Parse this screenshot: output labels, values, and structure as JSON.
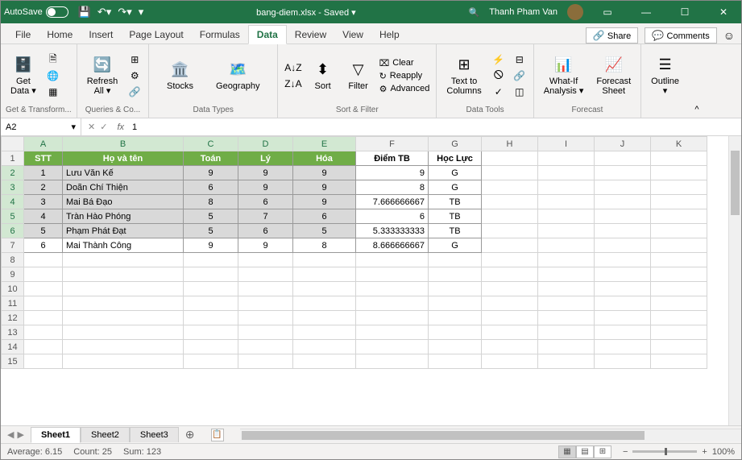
{
  "title": {
    "autosave": "AutoSave",
    "filename": "bang-diem.xlsx",
    "saved": "- Saved ▾",
    "user": "Thanh Pham Van"
  },
  "tabs": [
    "File",
    "Home",
    "Insert",
    "Page Layout",
    "Formulas",
    "Data",
    "Review",
    "View",
    "Help"
  ],
  "activeTab": "Data",
  "share": "Share",
  "comments": "Comments",
  "ribbon": {
    "getdata": "Get\nData ▾",
    "refreshall": "Refresh\nAll ▾",
    "stocks": "Stocks",
    "geo": "Geography",
    "sort": "Sort",
    "filter": "Filter",
    "clear": "Clear",
    "reapply": "Reapply",
    "advanced": "Advanced",
    "t2c": "Text to\nColumns",
    "whatif": "What-If\nAnalysis ▾",
    "forecast": "Forecast\nSheet",
    "outline": "Outline\n▾",
    "g1": "Get & Transform...",
    "g2": "Queries & Co...",
    "g3": "Data Types",
    "g4": "Sort & Filter",
    "g5": "Data Tools",
    "g6": "Forecast"
  },
  "namebox": "A2",
  "fvalue": "1",
  "cols": [
    "A",
    "B",
    "C",
    "D",
    "E",
    "F",
    "G",
    "H",
    "I",
    "J",
    "K"
  ],
  "headers": {
    "A": "STT",
    "B": "Họ và tên",
    "C": "Toán",
    "D": "Lý",
    "E": "Hóa",
    "F": "Điểm TB",
    "G": "Học Lực"
  },
  "rows": [
    {
      "stt": "1",
      "name": "Lưu Văn Kế",
      "t": "9",
      "l": "9",
      "h": "9",
      "tb": "9",
      "hl": "G"
    },
    {
      "stt": "2",
      "name": "Doãn Chí Thiện",
      "t": "6",
      "l": "9",
      "h": "9",
      "tb": "8",
      "hl": "G"
    },
    {
      "stt": "3",
      "name": "Mai Bá Đạo",
      "t": "8",
      "l": "6",
      "h": "9",
      "tb": "7.666666667",
      "hl": "TB"
    },
    {
      "stt": "4",
      "name": "Tràn Hào Phóng",
      "t": "5",
      "l": "7",
      "h": "6",
      "tb": "6",
      "hl": "TB"
    },
    {
      "stt": "5",
      "name": "Phạm Phát Đạt",
      "t": "5",
      "l": "6",
      "h": "5",
      "tb": "5.333333333",
      "hl": "TB"
    },
    {
      "stt": "6",
      "name": "Mai Thành Công",
      "t": "9",
      "l": "9",
      "h": "8",
      "tb": "8.666666667",
      "hl": "G"
    }
  ],
  "sheets": [
    "Sheet1",
    "Sheet2",
    "Sheet3"
  ],
  "status": {
    "avg": "Average: 6.15",
    "count": "Count: 25",
    "sum": "Sum: 123",
    "zoom": "100%"
  }
}
